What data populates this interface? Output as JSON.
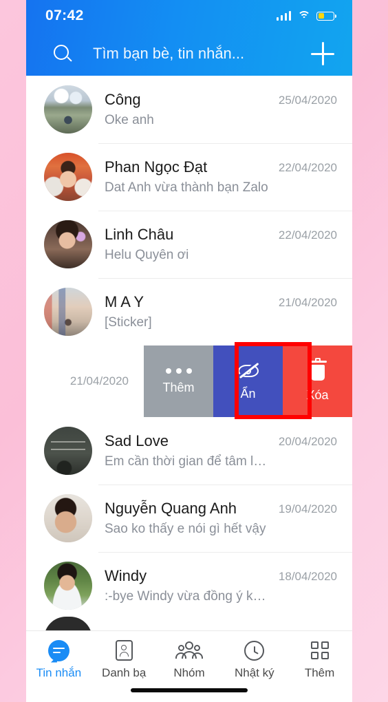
{
  "theme": {
    "page_background": "#fbc2dc",
    "header_gradient_start": "#1573f0",
    "header_gradient_end": "#12a5ef",
    "accent": "#1a8cf5",
    "hide_action_color": "#4250bd",
    "delete_action_color": "#f4483e",
    "more_action_color": "#9aa1a8",
    "highlight_border": "#ff0000",
    "battery_color": "#ffd60a"
  },
  "status_bar": {
    "time": "07:42",
    "signal_icon": "cellular-signal-icon",
    "wifi_icon": "wifi-icon",
    "battery_icon": "battery-icon",
    "battery_level_percent": 40
  },
  "search": {
    "placeholder": "Tìm bạn bè, tin nhắn...",
    "search_icon": "search-icon",
    "add_icon": "plus-icon"
  },
  "conversations": [
    {
      "name": "Công",
      "message": "Oke anh",
      "date": "25/04/2020",
      "avatar_name": "avatar-cong"
    },
    {
      "name": "Phan Ngọc Đạt",
      "message": "Dat Anh vừa thành bạn Zalo",
      "date": "22/04/2020",
      "avatar_name": "avatar-phan-ngoc-dat"
    },
    {
      "name": "Linh Châu",
      "message": "Helu Quyên ơi",
      "date": "22/04/2020",
      "avatar_name": "avatar-linh-chau"
    },
    {
      "name": "M A Y",
      "message": "[Sticker]",
      "date": "21/04/2020",
      "avatar_name": "avatar-may"
    }
  ],
  "swiped_row": {
    "date": "21/04/2020",
    "highlighted_action": "Ẩn",
    "actions": [
      {
        "label": "Thêm",
        "icon": "more-dots-icon",
        "color": "#9aa1a8"
      },
      {
        "label": "Ẩn",
        "icon": "eye-slash-icon",
        "color": "#4250bd"
      },
      {
        "label": "Xóa",
        "icon": "trash-icon",
        "color": "#f4483e"
      }
    ]
  },
  "conversations_lower": [
    {
      "name": "Sad Love",
      "message": "Em cần thời gian để tâm lý ổn. C xem có...",
      "date": "20/04/2020",
      "avatar_name": "avatar-sad-love"
    },
    {
      "name": "Nguyễn Quang Anh",
      "message": "Sao ko thấy e nói gì hết vậy",
      "date": "19/04/2020",
      "avatar_name": "avatar-nguyen-quang-anh"
    },
    {
      "name": "Windy",
      "message": ":-bye Windy vừa đồng ý kết bạn, gửi lời c...",
      "date": "18/04/2020",
      "avatar_name": "avatar-windy"
    }
  ],
  "tabs": [
    {
      "label": "Tin nhắn",
      "icon": "message-bubble-icon",
      "active": true
    },
    {
      "label": "Danh bạ",
      "icon": "contact-card-icon",
      "active": false
    },
    {
      "label": "Nhóm",
      "icon": "group-people-icon",
      "active": false
    },
    {
      "label": "Nhật ký",
      "icon": "clock-icon",
      "active": false
    },
    {
      "label": "Thêm",
      "icon": "grid-icon",
      "active": false
    }
  ]
}
